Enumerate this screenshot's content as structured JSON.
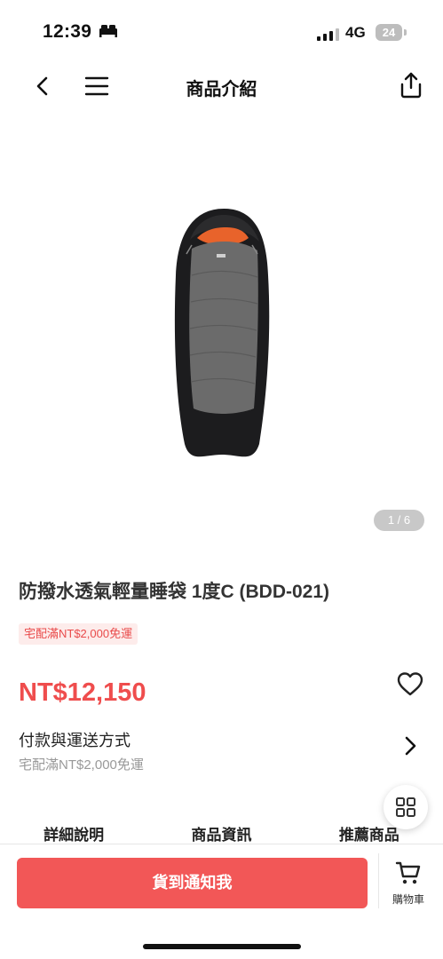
{
  "status_bar": {
    "time": "12:39",
    "network": "4G",
    "battery": "24"
  },
  "nav": {
    "title": "商品介紹",
    "icons": [
      "chevron-left-icon",
      "menu-icon",
      "share-icon"
    ]
  },
  "product": {
    "image_counter": "1 / 6",
    "title": "防撥水透氣輕量睡袋 1度C (BDD-021)",
    "promo_badge": "宅配滿NT$2,000免運",
    "price": "NT$12,150"
  },
  "payment": {
    "title": "付款與運送方式",
    "subtitle": "宅配滿NT$2,000免運"
  },
  "tabs": [
    {
      "label": "詳細說明"
    },
    {
      "label": "商品資訊"
    },
    {
      "label": "推薦商品"
    }
  ],
  "bottom_bar": {
    "notify_label": "貨到通知我",
    "cart_label": "購物車"
  },
  "colors": {
    "accent": "#f25757",
    "price": "#ef4d4d",
    "badge_bg": "#fdeceb",
    "bag_orange": "#e8632b",
    "bag_gray": "#6b6b6b",
    "bag_black": "#1c1c1e"
  }
}
